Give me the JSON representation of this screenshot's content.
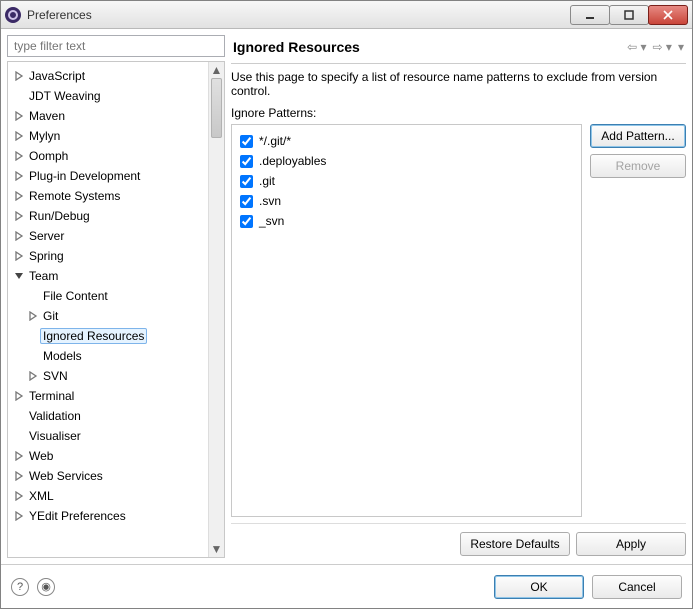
{
  "window": {
    "title": "Preferences"
  },
  "filter": {
    "placeholder": "type filter text"
  },
  "tree": [
    {
      "label": "JavaScript",
      "expandable": true,
      "expanded": false,
      "indent": 0
    },
    {
      "label": "JDT Weaving",
      "expandable": false,
      "indent": 0
    },
    {
      "label": "Maven",
      "expandable": true,
      "expanded": false,
      "indent": 0
    },
    {
      "label": "Mylyn",
      "expandable": true,
      "expanded": false,
      "indent": 0
    },
    {
      "label": "Oomph",
      "expandable": true,
      "expanded": false,
      "indent": 0
    },
    {
      "label": "Plug-in Development",
      "expandable": true,
      "expanded": false,
      "indent": 0
    },
    {
      "label": "Remote Systems",
      "expandable": true,
      "expanded": false,
      "indent": 0
    },
    {
      "label": "Run/Debug",
      "expandable": true,
      "expanded": false,
      "indent": 0
    },
    {
      "label": "Server",
      "expandable": true,
      "expanded": false,
      "indent": 0
    },
    {
      "label": "Spring",
      "expandable": true,
      "expanded": false,
      "indent": 0
    },
    {
      "label": "Team",
      "expandable": true,
      "expanded": true,
      "indent": 0
    },
    {
      "label": "File Content",
      "expandable": false,
      "indent": 1
    },
    {
      "label": "Git",
      "expandable": true,
      "expanded": false,
      "indent": 1
    },
    {
      "label": "Ignored Resources",
      "expandable": false,
      "indent": 1,
      "selected": true
    },
    {
      "label": "Models",
      "expandable": false,
      "indent": 1
    },
    {
      "label": "SVN",
      "expandable": true,
      "expanded": false,
      "indent": 1
    },
    {
      "label": "Terminal",
      "expandable": true,
      "expanded": false,
      "indent": 0
    },
    {
      "label": "Validation",
      "expandable": false,
      "indent": 0
    },
    {
      "label": "Visualiser",
      "expandable": false,
      "indent": 0
    },
    {
      "label": "Web",
      "expandable": true,
      "expanded": false,
      "indent": 0
    },
    {
      "label": "Web Services",
      "expandable": true,
      "expanded": false,
      "indent": 0
    },
    {
      "label": "XML",
      "expandable": true,
      "expanded": false,
      "indent": 0
    },
    {
      "label": "YEdit Preferences",
      "expandable": true,
      "expanded": false,
      "indent": 0
    }
  ],
  "page": {
    "title": "Ignored Resources",
    "description": "Use this page to specify a list of resource name patterns to exclude from version control.",
    "patterns_label": "Ignore Patterns:",
    "patterns": [
      {
        "text": "*/.git/*",
        "checked": true
      },
      {
        "text": ".deployables",
        "checked": true
      },
      {
        "text": ".git",
        "checked": true
      },
      {
        "text": ".svn",
        "checked": true
      },
      {
        "text": "_svn",
        "checked": true
      }
    ],
    "buttons": {
      "add": "Add Pattern...",
      "remove": "Remove",
      "restore": "Restore Defaults",
      "apply": "Apply"
    }
  },
  "dialog": {
    "ok": "OK",
    "cancel": "Cancel"
  }
}
